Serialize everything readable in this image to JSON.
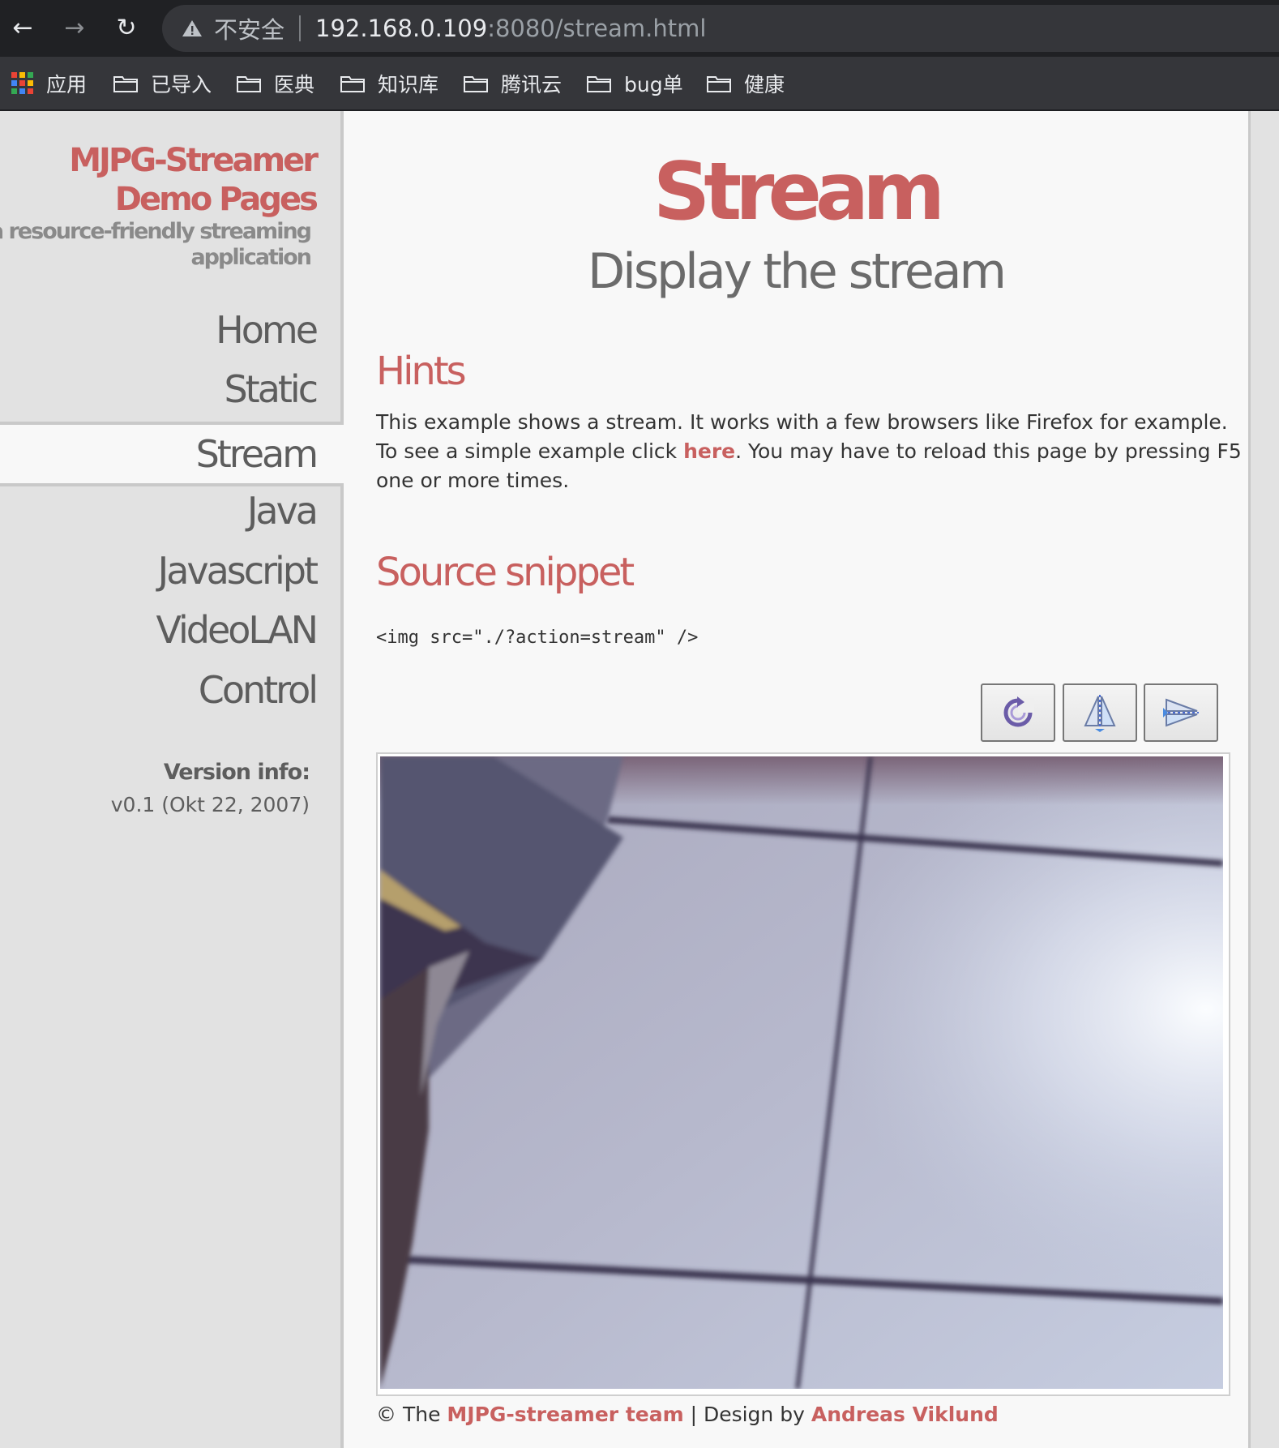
{
  "browser": {
    "back_glyph": "←",
    "forward_glyph": "→",
    "reload_glyph": "↻",
    "security_label": "不安全",
    "url_host": "192.168.0.109",
    "url_path": ":8080/stream.html",
    "bookmarks": [
      "应用",
      "已导入",
      "医典",
      "知识库",
      "腾讯云",
      "bug单",
      "健康"
    ]
  },
  "sidebar": {
    "brand_line1": "MJPG-Streamer",
    "brand_line2": "Demo Pages",
    "tagline": "a resource-friendly streaming application",
    "nav": [
      "Home",
      "Static",
      "Stream",
      "Java",
      "Javascript",
      "VideoLAN",
      "Control"
    ],
    "active_nav": "Stream",
    "version_label": "Version info:",
    "version_value": "v0.1 (Okt 22, 2007)"
  },
  "main": {
    "title": "Stream",
    "subtitle": "Display the stream",
    "hints_heading": "Hints",
    "hints_text_1": "This example shows a stream. It works with a few browsers like Firefox for example. To see a simple example click ",
    "hints_link": "here",
    "hints_text_2": ". You may have to reload this page by pressing F5 one or more times.",
    "source_heading": "Source snippet",
    "source_code": "<img src=\"./?action=stream\" />",
    "toolbar_icons": [
      "rotate-icon",
      "flip-icon",
      "mirror-icon"
    ]
  },
  "footer": {
    "prefix": "© The ",
    "team_link": "MJPG-streamer team",
    "middle": " | Design by ",
    "designer_link": "Andreas Viklund"
  },
  "colors": {
    "accent": "#c8605f",
    "sidebar_bg": "#e2e2e2",
    "content_bg": "#f8f8f8",
    "chrome_bg": "#202124"
  }
}
